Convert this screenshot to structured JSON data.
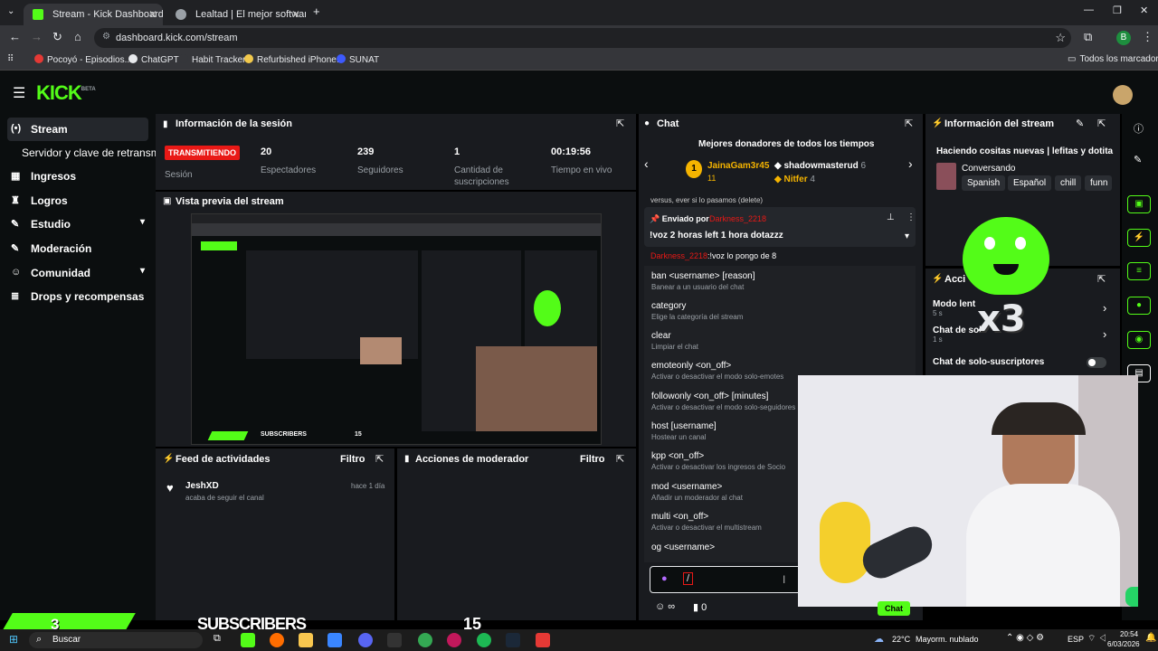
{
  "browser": {
    "tabs": [
      {
        "title": "Stream - Kick Dashboard",
        "active": true
      },
      {
        "title": "Lealtad | El mejor software para",
        "active": false
      }
    ],
    "url": "dashboard.kick.com/stream",
    "bookmarks": [
      "Pocoyó - Episodios...",
      "ChatGPT",
      "Habit Tracker",
      "Refurbished iPhone...",
      "SUNAT"
    ],
    "all_bookmarks": "Todos los marcadores",
    "profile_letter": "B"
  },
  "kick": {
    "logo": "KICK",
    "logo_sup": "BETA",
    "sidebar": [
      {
        "label": "Stream",
        "icon": "stream-icon"
      },
      {
        "label": "Servidor y clave de retransmisión",
        "icon": ""
      },
      {
        "label": "Ingresos",
        "icon": "dollar-icon"
      },
      {
        "label": "Logros",
        "icon": "trophy-icon"
      },
      {
        "label": "Estudio",
        "icon": "brush-icon",
        "chevron": true
      },
      {
        "label": "Moderación",
        "icon": "wrench-icon"
      },
      {
        "label": "Comunidad",
        "icon": "people-icon",
        "chevron": true
      },
      {
        "label": "Drops y recompensas",
        "icon": "gift-icon"
      }
    ],
    "session": {
      "title": "Información de la sesión",
      "live_badge": "TRANSMITIENDO",
      "session_label": "Sesión",
      "stats": [
        {
          "value": "20",
          "label": "Espectadores"
        },
        {
          "value": "239",
          "label": "Seguidores"
        },
        {
          "value": "1",
          "label": "Cantidad de suscripciones"
        },
        {
          "value": "00:19:56",
          "label": "Tiempo en vivo"
        }
      ]
    },
    "preview": {
      "title": "Vista previa del stream",
      "subscribers_text": "SUBSCRIBERS",
      "subscribers_count": "15"
    },
    "activity": {
      "title": "Feed de actividades",
      "filter": "Filtro",
      "items": [
        {
          "user": "JeshXD",
          "action": "acaba de seguir el canal",
          "time": "hace 1 día"
        }
      ]
    },
    "mod_actions": {
      "title": "Acciones de moderador",
      "filter": "Filtro"
    },
    "chat": {
      "title": "Chat",
      "donors_title": "Mejores donadores de todos los tiempos",
      "donors": [
        {
          "rank": "1",
          "name": "JainaGam3r45",
          "count": "11"
        },
        {
          "rank": "",
          "name": "shadowmasterud",
          "count": "6"
        },
        {
          "rank": "",
          "name": "Nitfer",
          "count": "4"
        }
      ],
      "partial_line": "versus, ever si lo pasamos (delete)",
      "pinned_label": "Enviado por",
      "pinned_user": "Darkness_2218",
      "pinned_message": "!voz 2 horas left 1 hora dotazzz",
      "last_user": "Darkness_2218",
      "last_message": ":!voz lo pongo de 8",
      "commands": [
        {
          "cmd": "ban <username> [reason]",
          "desc": "Banear a un usuario del chat"
        },
        {
          "cmd": "category",
          "desc": "Elige la categoría del stream"
        },
        {
          "cmd": "clear",
          "desc": "Limpiar el chat"
        },
        {
          "cmd": "emoteonly <on_off>",
          "desc": "Activar o desactivar el modo solo-emotes"
        },
        {
          "cmd": "followonly <on_off> [minutes]",
          "desc": "Activar o desactivar el modo solo-seguidores"
        },
        {
          "cmd": "host [username]",
          "desc": "Hostear un canal"
        },
        {
          "cmd": "kpp <on_off>",
          "desc": "Activar o desactivar los ingresos de Socio"
        },
        {
          "cmd": "mod <username>",
          "desc": "Añadir un moderador al chat"
        },
        {
          "cmd": "multi <on_off>",
          "desc": "Activar o desactivar el multistream"
        },
        {
          "cmd": "og <username>",
          "desc": ""
        }
      ],
      "input_value": "/",
      "viewers_count": "0",
      "send_label": "Chat"
    },
    "stream_info": {
      "title": "Información del stream",
      "stream_title": "Haciendo cositas nuevas | lefitas y dotita",
      "category": "Conversando",
      "tags": [
        "Spanish",
        "Español",
        "chill",
        "funn"
      ]
    },
    "quick_actions": {
      "title_partial": "Acci",
      "items": [
        {
          "label": "Modo lent",
          "sub": "5 s"
        },
        {
          "label": "Chat de solo",
          "sub": "1 s"
        },
        {
          "label": "Chat de solo-suscriptores",
          "sub": ""
        }
      ]
    },
    "overlay": {
      "emote_multiplier": "x3",
      "bar_count": "3",
      "bar_text": "SUBSCRIBERS",
      "bar_number": "15"
    }
  },
  "taskbar": {
    "search": "Buscar",
    "weather": "22°C",
    "weather_desc": "Mayorm. nublado",
    "lang": "ESP",
    "time": "20:54",
    "date": "6/03/2026"
  },
  "colors": {
    "accent": "#53fc18",
    "live": "#e91916",
    "panel": "#191b1f",
    "page": "#0b0e0f"
  }
}
